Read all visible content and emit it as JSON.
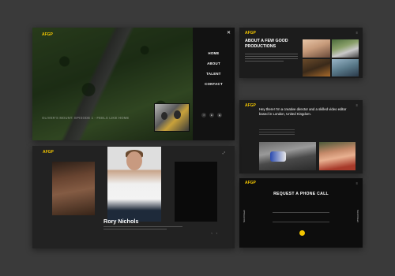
{
  "brand": {
    "logo_mark": "AFGP",
    "accent": "#f2c500"
  },
  "panel_home": {
    "episode_title": "OLIVER'S MOUNT: EPISODE 1 - FEELS LIKE HOME",
    "menu": [
      "HOME",
      "ABOUT",
      "TALENT",
      "CONTACT"
    ],
    "close_icon": "close-icon",
    "socials": [
      "f",
      "in",
      "ig"
    ]
  },
  "panel_about": {
    "heading": "ABOUT A FEW GOOD PRODUCTIONS"
  },
  "panel_bio": {
    "bio": "Hey there! I'm a creative director and a skilled video editor based in London, United Kingdom."
  },
  "panel_talent": {
    "name": "Rory Nichols"
  },
  "panel_contact": {
    "heading": "REQUEST A PHONE CALL",
    "side_left": "Scroll Down",
    "side_right": "Scroll Down"
  }
}
